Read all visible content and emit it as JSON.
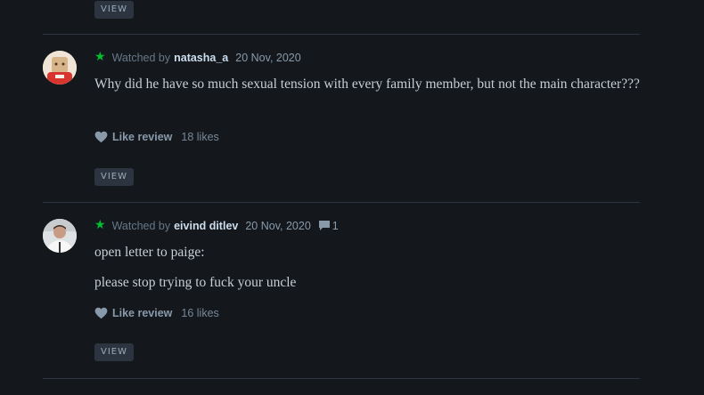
{
  "top_view_button": "VIEW",
  "reviews": [
    {
      "watched_prefix": "Watched by",
      "username": "natasha_a",
      "date": "20 Nov, 2020",
      "comment_count": "",
      "paragraphs": [
        "Why did he have so much sexual tension with every family member, but not the main character???"
      ],
      "like_label": "Like review",
      "likes": "18 likes",
      "view_label": "VIEW"
    },
    {
      "watched_prefix": "Watched by",
      "username": "eivind ditlev",
      "date": "20 Nov, 2020",
      "comment_count": "1",
      "paragraphs": [
        "open letter to paige:",
        "please stop trying to fuck your uncle"
      ],
      "like_label": "Like review",
      "likes": "16 likes",
      "view_label": "VIEW"
    }
  ],
  "colors": {
    "background": "#14181c",
    "star": "#00c030",
    "button": "#2c3440"
  }
}
